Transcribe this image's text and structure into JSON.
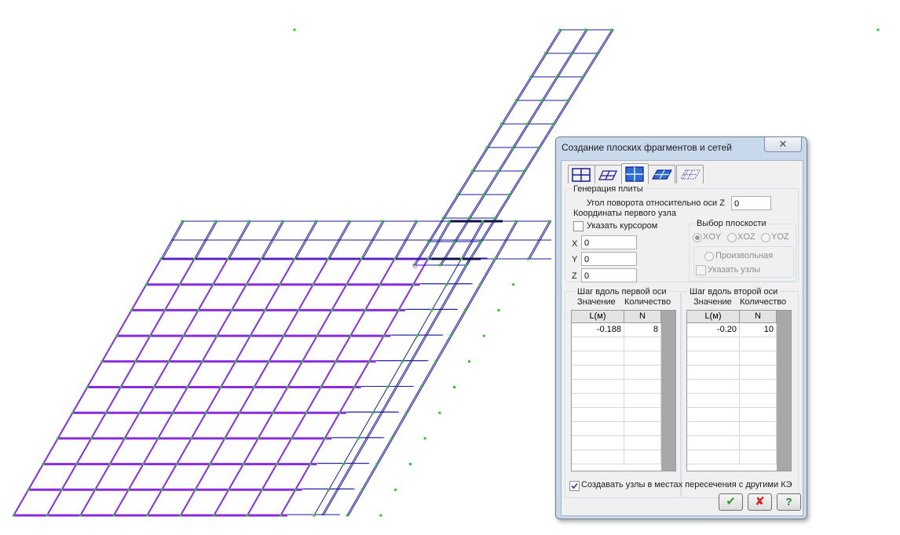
{
  "dialog": {
    "title": "Создание плоских фрагментов и сетей",
    "close_label": "✕",
    "tabs": [
      {
        "icon": "grid-rect-icon",
        "active": false
      },
      {
        "icon": "grid-skew-icon",
        "active": false
      },
      {
        "icon": "grid-blue-rect-icon",
        "active": true
      },
      {
        "icon": "grid-blue-skew-icon",
        "active": false
      },
      {
        "icon": "grid-dashed-icon",
        "active": false
      }
    ],
    "plate_group_label": "Генерация плиты",
    "rotation_label": "Угол поворота относительно оси Z",
    "rotation_value": "0",
    "first_node_label": "Координаты первого узла",
    "cursor_checkbox_label": "Указать курсором",
    "x_label": "X",
    "x_value": "0",
    "y_label": "Y",
    "y_value": "0",
    "z_label": "Z",
    "z_value": "0",
    "plane_label": "Выбор плоскости",
    "radio_xoy": "XOY",
    "radio_xoz": "XOZ",
    "radio_yoz": "YOZ",
    "radio_arbitrary": "Произвольная",
    "specify_nodes_label": "Указать узлы",
    "axis1": {
      "title": "Шаг вдоль первой оси",
      "value_label": "Значение",
      "count_label": "Количество",
      "col_l": "L(м)",
      "col_n": "N",
      "rows": [
        [
          "-0.188",
          "8"
        ]
      ]
    },
    "axis2": {
      "title": "Шаг вдоль второй оси",
      "value_label": "Значение",
      "count_label": "Количество",
      "col_l": "L(м)",
      "col_n": "N",
      "rows": [
        [
          "-0.20",
          "10"
        ]
      ]
    },
    "create_nodes_label": "Создавать узлы в местах пересечения с другими КЭ",
    "create_nodes_checked": true,
    "ok_label": "✔",
    "cancel_label": "✘",
    "help_label": "?"
  },
  "canvas": {
    "node_label": "0",
    "colors": {
      "mesh": "#1a1a9c",
      "highlight": "#8a2be2",
      "node": "#22cc22"
    }
  }
}
